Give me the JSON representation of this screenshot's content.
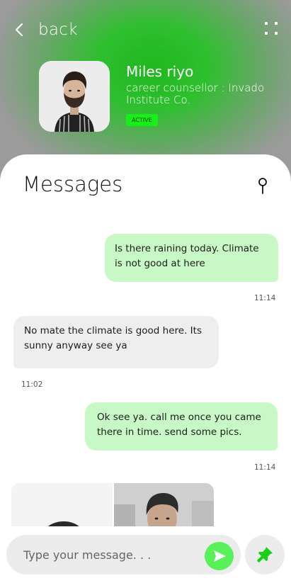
{
  "header": {
    "back_label": "back",
    "back_icon": "chevron-left-icon",
    "menu_icon": "more-dots-icon"
  },
  "profile": {
    "name": "Miles riyo",
    "role": "career counsellor : Invado Institute Co.",
    "status": "ACTIVE",
    "status_color": "#17f017"
  },
  "messages_panel": {
    "title": "Messages",
    "pin_icon": "pin-icon"
  },
  "messages": [
    {
      "direction": "outgoing",
      "text": "Is there raining today. Climate is not good at here",
      "time": "11:14"
    },
    {
      "direction": "incoming",
      "text": "No mate the climate is good here. Its sunny anyway see ya",
      "time": "11:02"
    },
    {
      "direction": "outgoing",
      "text": "Ok see ya. call me once you came there in time. send some pics.",
      "time": "11:14"
    }
  ],
  "composer": {
    "placeholder": "Type your message. . .",
    "send_icon": "send-icon",
    "attach_icon": "pushpin-icon"
  },
  "colors": {
    "accent_green": "#2fbf2f",
    "outgoing_bubble": "#c9f8c7",
    "incoming_bubble": "#eeeeee",
    "send_button": "#5af05a"
  }
}
